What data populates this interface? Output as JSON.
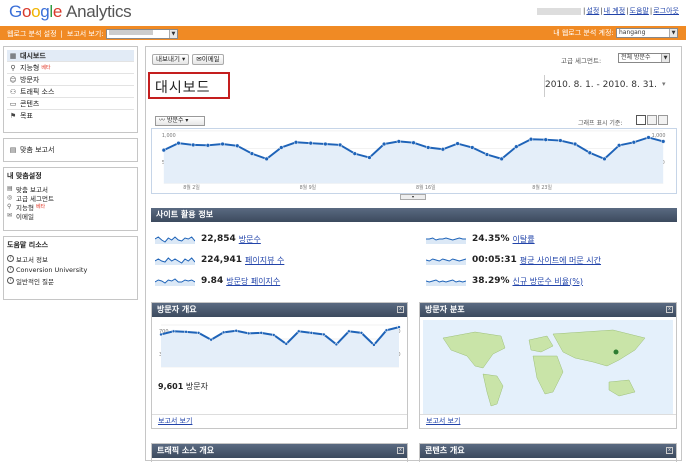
{
  "app": {
    "logo_google": [
      "G",
      "o",
      "o",
      "g",
      "l",
      "e"
    ],
    "logo_product": "Analytics"
  },
  "toplinks": {
    "settings": "설정",
    "my_account": "내 계정",
    "help": "도움말",
    "logout": "로그아웃",
    "sep": "|"
  },
  "orangebar": {
    "analytics_settings": "웹로그 분석 설정",
    "sep": "|",
    "view_reports": "보고서 보기:",
    "my_account_label": "내 웹로그 분석 계정:",
    "profile_value": "hangang"
  },
  "sidebar": {
    "nav": [
      {
        "label": "대시보드",
        "icon": "dashboard-icon"
      },
      {
        "label": "지능형",
        "icon": "lightbulb-icon",
        "beta": "베타"
      },
      {
        "label": "방문자",
        "icon": "person-icon"
      },
      {
        "label": "트래픽 소스",
        "icon": "people-icon"
      },
      {
        "label": "콘텐츠",
        "icon": "page-icon"
      },
      {
        "label": "목표",
        "icon": "flag-icon"
      }
    ],
    "custom_reports": "맞춤 보고서",
    "my_custom_title": "내 맞춤설정",
    "my_custom": [
      {
        "label": "맞춤 보고서",
        "icon": "report-icon"
      },
      {
        "label": "고급 세그먼트",
        "icon": "segment-icon"
      },
      {
        "label": "지능형",
        "icon": "lightbulb-icon",
        "beta": "베타"
      },
      {
        "label": "이메일",
        "icon": "email-icon"
      }
    ],
    "help_title": "도움말 리소스",
    "help_items": [
      {
        "label": "보고서 정보"
      },
      {
        "label": "Conversion University"
      },
      {
        "label": "일반적인 질문"
      }
    ]
  },
  "main": {
    "toolbar": {
      "export": "내보내기",
      "email": "이메일"
    },
    "segment_label": "고급 세그먼트:",
    "segment_value": "전체 방문수",
    "title": "대시보드",
    "daterange": "2010. 8. 1. - 2010. 8. 31.",
    "daterange_arrow": "▾",
    "metric_select": "방문수",
    "graph_by_label": "그래프 표시 기준:",
    "chart_y_labels": [
      "1,000",
      "500"
    ],
    "chart_y_right": [
      "1,000",
      "500"
    ],
    "chart_x_labels": [
      "8월 2일",
      "8월 9일",
      "8월 16일",
      "8월 23일"
    ],
    "site_usage_title": "사이트 활용 정보",
    "site_usage": [
      {
        "value": "22,854",
        "label": "방문수"
      },
      {
        "value": "24.35%",
        "label": "이탈률"
      },
      {
        "value": "224,941",
        "label": "페이지뷰 수"
      },
      {
        "value": "00:05:31",
        "label": "평균 사이트에 머문 시간"
      },
      {
        "value": "9.84",
        "label": "방문당 페이지수"
      },
      {
        "value": "38.29%",
        "label": "신규 방문수 비율(%)"
      }
    ],
    "visitors_overview_title": "방문자 개요",
    "visitors_overview_y": [
      "700",
      "350"
    ],
    "visitors_overview_count": "9,601",
    "visitors_overview_count_label": "방문자",
    "view_report": "보고서 보기",
    "map_overlay_title": "방문자 분포",
    "traffic_sources_title": "트래픽 소스 개요",
    "content_overview_title": "콘텐츠 개요"
  },
  "chart_data": [
    {
      "type": "line",
      "series": [
        {
          "name": "방문수",
          "values": [
            760,
            920,
            880,
            870,
            900,
            860,
            680,
            560,
            820,
            940,
            920,
            900,
            880,
            680,
            590,
            900,
            960,
            930,
            820,
            780,
            910,
            820,
            660,
            560,
            840,
            1010,
            1000,
            980,
            900,
            700,
            560,
            870,
            940,
            1050,
            960
          ]
        }
      ],
      "ylim": [
        0,
        1200
      ]
    },
    {
      "type": "line",
      "series": [
        {
          "values": [
            620,
            680,
            670,
            650,
            520,
            660,
            690,
            640,
            650,
            610,
            440,
            680,
            650,
            620,
            430,
            680,
            650,
            420,
            700,
            760
          ]
        }
      ],
      "ylim": [
        0,
        800
      ]
    }
  ],
  "colors": {
    "orange": "#f08a24",
    "line_blue": "#1e63b8",
    "fill_blue": "#e4eef9",
    "header_dark": "#4b5a70",
    "highlight_red": "#c41e1e"
  }
}
